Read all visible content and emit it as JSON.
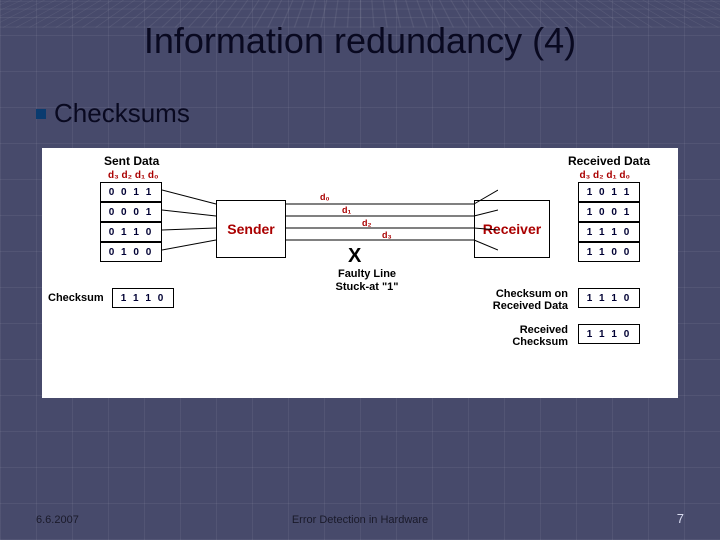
{
  "title": "Information redundancy (4)",
  "bullet": "Checksums",
  "diagram": {
    "sent_header": "Sent Data",
    "recv_header": "Received Data",
    "bit_labels_left": "d₃ d₂ d₁ d₀",
    "bit_labels_right": "d₃ d₂ d₁ d₀",
    "sent_rows": [
      "0 0 1 1",
      "0 0 0 1",
      "0 1 1 0",
      "0 1 0 0"
    ],
    "recv_rows": [
      "1 0 1 1",
      "1 0 0 1",
      "1 1 1 0",
      "1 1 0 0"
    ],
    "checksum_left_label": "Checksum",
    "checksum_left_value": "1 1 1 0",
    "recv_cs_label": "Checksum on\nReceived Data",
    "recv_cs_value": "1 1 1 0",
    "recv_cs2_label": "Received\nChecksum",
    "recv_cs2_value": "1 1 1 0",
    "sender": "Sender",
    "receiver": "Receiver",
    "bus_labels": [
      "d₀",
      "d₁",
      "d₂",
      "d₃"
    ],
    "fault_x": "X",
    "fault_label": "Faulty Line\nStuck-at \"1\""
  },
  "footer": {
    "date": "6.6.2007",
    "title": "Error Detection in Hardware",
    "page": "7"
  }
}
